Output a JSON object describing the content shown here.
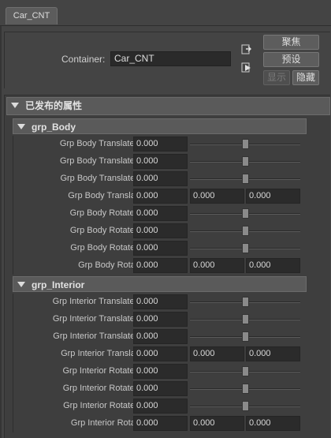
{
  "tab": {
    "label": "Car_CNT"
  },
  "container": {
    "label": "Container:",
    "value": "Car_CNT"
  },
  "buttons": {
    "focus": "聚焦",
    "preset": "预设",
    "show": "显示",
    "hide": "隐藏"
  },
  "published": {
    "title": "已发布的属性"
  },
  "groups": [
    {
      "title": "grp_Body",
      "rows": [
        {
          "label": "Grp Body Translate X",
          "type": "slider",
          "value": "0.000",
          "level": 0.5
        },
        {
          "label": "Grp Body Translate Y",
          "type": "slider",
          "value": "0.000",
          "level": 0.5
        },
        {
          "label": "Grp Body Translate Z",
          "type": "slider",
          "value": "0.000",
          "level": 0.5
        },
        {
          "label": "Grp Body Translate",
          "type": "triple",
          "values": [
            "0.000",
            "0.000",
            "0.000"
          ]
        },
        {
          "label": "Grp Body Rotate X",
          "type": "slider",
          "value": "0.000",
          "level": 0.5
        },
        {
          "label": "Grp Body Rotate Y",
          "type": "slider",
          "value": "0.000",
          "level": 0.5
        },
        {
          "label": "Grp Body Rotate Z",
          "type": "slider",
          "value": "0.000",
          "level": 0.5
        },
        {
          "label": "Grp Body Rotate",
          "type": "triple",
          "values": [
            "0.000",
            "0.000",
            "0.000"
          ]
        }
      ]
    },
    {
      "title": "grp_Interior",
      "rows": [
        {
          "label": "Grp Interior Translate X",
          "type": "slider",
          "value": "0.000",
          "level": 0.5
        },
        {
          "label": "Grp Interior Translate Y",
          "type": "slider",
          "value": "0.000",
          "level": 0.5
        },
        {
          "label": "Grp Interior Translate Z",
          "type": "slider",
          "value": "0.000",
          "level": 0.5
        },
        {
          "label": "Grp Interior Translate",
          "type": "triple",
          "values": [
            "0.000",
            "0.000",
            "0.000"
          ]
        },
        {
          "label": "Grp Interior Rotate X",
          "type": "slider",
          "value": "0.000",
          "level": 0.5
        },
        {
          "label": "Grp Interior Rotate Y",
          "type": "slider",
          "value": "0.000",
          "level": 0.5
        },
        {
          "label": "Grp Interior Rotate Z",
          "type": "slider",
          "value": "0.000",
          "level": 0.5
        },
        {
          "label": "Grp Interior Rotate",
          "type": "triple",
          "values": [
            "0.000",
            "0.000",
            "0.000"
          ]
        }
      ]
    }
  ],
  "icons": {
    "select": "select-container-icon",
    "arrow": "enter-container-icon"
  }
}
